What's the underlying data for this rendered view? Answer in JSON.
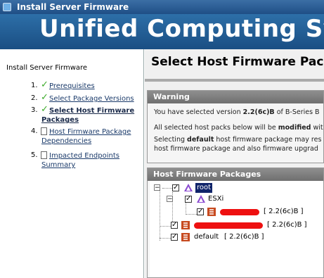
{
  "window": {
    "title": "Install Server Firmware"
  },
  "banner": {
    "title": "Unified Computing Syst"
  },
  "wizard": {
    "title": "Install Server Firmware",
    "steps": [
      {
        "num": "1.",
        "label": "Prerequisites",
        "state": "complete"
      },
      {
        "num": "2.",
        "label": "Select Package Versions",
        "state": "complete"
      },
      {
        "num": "3.",
        "label_line1": "Select Host Firmware",
        "label_line2": "Packages",
        "state": "current"
      },
      {
        "num": "4.",
        "label_line1": "Host Firmware Package",
        "label_line2": "Dependencies",
        "state": "pending"
      },
      {
        "num": "5.",
        "label_line1": "Impacted Endpoints",
        "label_line2": "Summary",
        "state": "pending"
      }
    ]
  },
  "main": {
    "heading": "Select Host Firmware Pack",
    "warning": {
      "title": "Warning",
      "line1_pre": "You have selected version ",
      "line1_bold": "2.2(6c)B",
      "line1_post": " of B-Series B",
      "line2_pre": "All selected host packs below will be ",
      "line2_bold": "modified",
      "line2_post": " wit",
      "line3_pre": "Selecting ",
      "line3_bold": "default",
      "line3_post": " host firmware package may res",
      "line4": "host firmware package and also firmware upgrad"
    },
    "packages": {
      "title": "Host Firmware Packages",
      "root_label": "root",
      "esxi_label": "ESXi",
      "esxi_child_version": "[ 2.2(6c)B ]",
      "root_child_version": "[ 2.2(6c)B ]",
      "default_label": "default",
      "default_version": "[ 2.2(6c)B ]"
    }
  },
  "colors": {
    "checkmark": "#3cab2a",
    "redaction": "#ee1010",
    "banner": "#1a4e83"
  }
}
